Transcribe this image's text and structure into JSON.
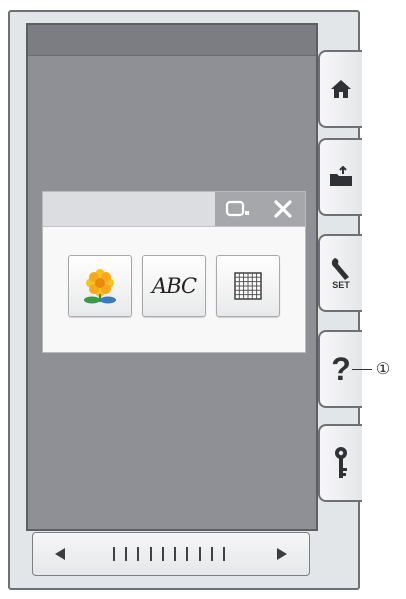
{
  "side_tabs": [
    {
      "id": "home",
      "icon": "home-icon"
    },
    {
      "id": "load",
      "icon": "folder-load-icon"
    },
    {
      "id": "set",
      "icon": "wrench-icon",
      "label": "SET"
    },
    {
      "id": "help",
      "icon": "help-icon",
      "label": "?"
    },
    {
      "id": "lock",
      "icon": "key-icon"
    }
  ],
  "dialog": {
    "controls": [
      "window-minimize-icon",
      "close-icon"
    ],
    "buttons": [
      {
        "id": "design",
        "icon": "flower-icon"
      },
      {
        "id": "text",
        "icon": "abc-text-icon",
        "label": "ABC"
      },
      {
        "id": "grid",
        "icon": "grid-icon"
      }
    ]
  },
  "callout": {
    "number": "①"
  },
  "bottom_bar": {
    "ticks": 10,
    "left": "arrow-left-icon",
    "right": "arrow-right-icon"
  },
  "colors": {
    "screen": "#8f9095",
    "panel": "#e3e6e8",
    "dialog_ctrl": "#a5a7ab"
  }
}
